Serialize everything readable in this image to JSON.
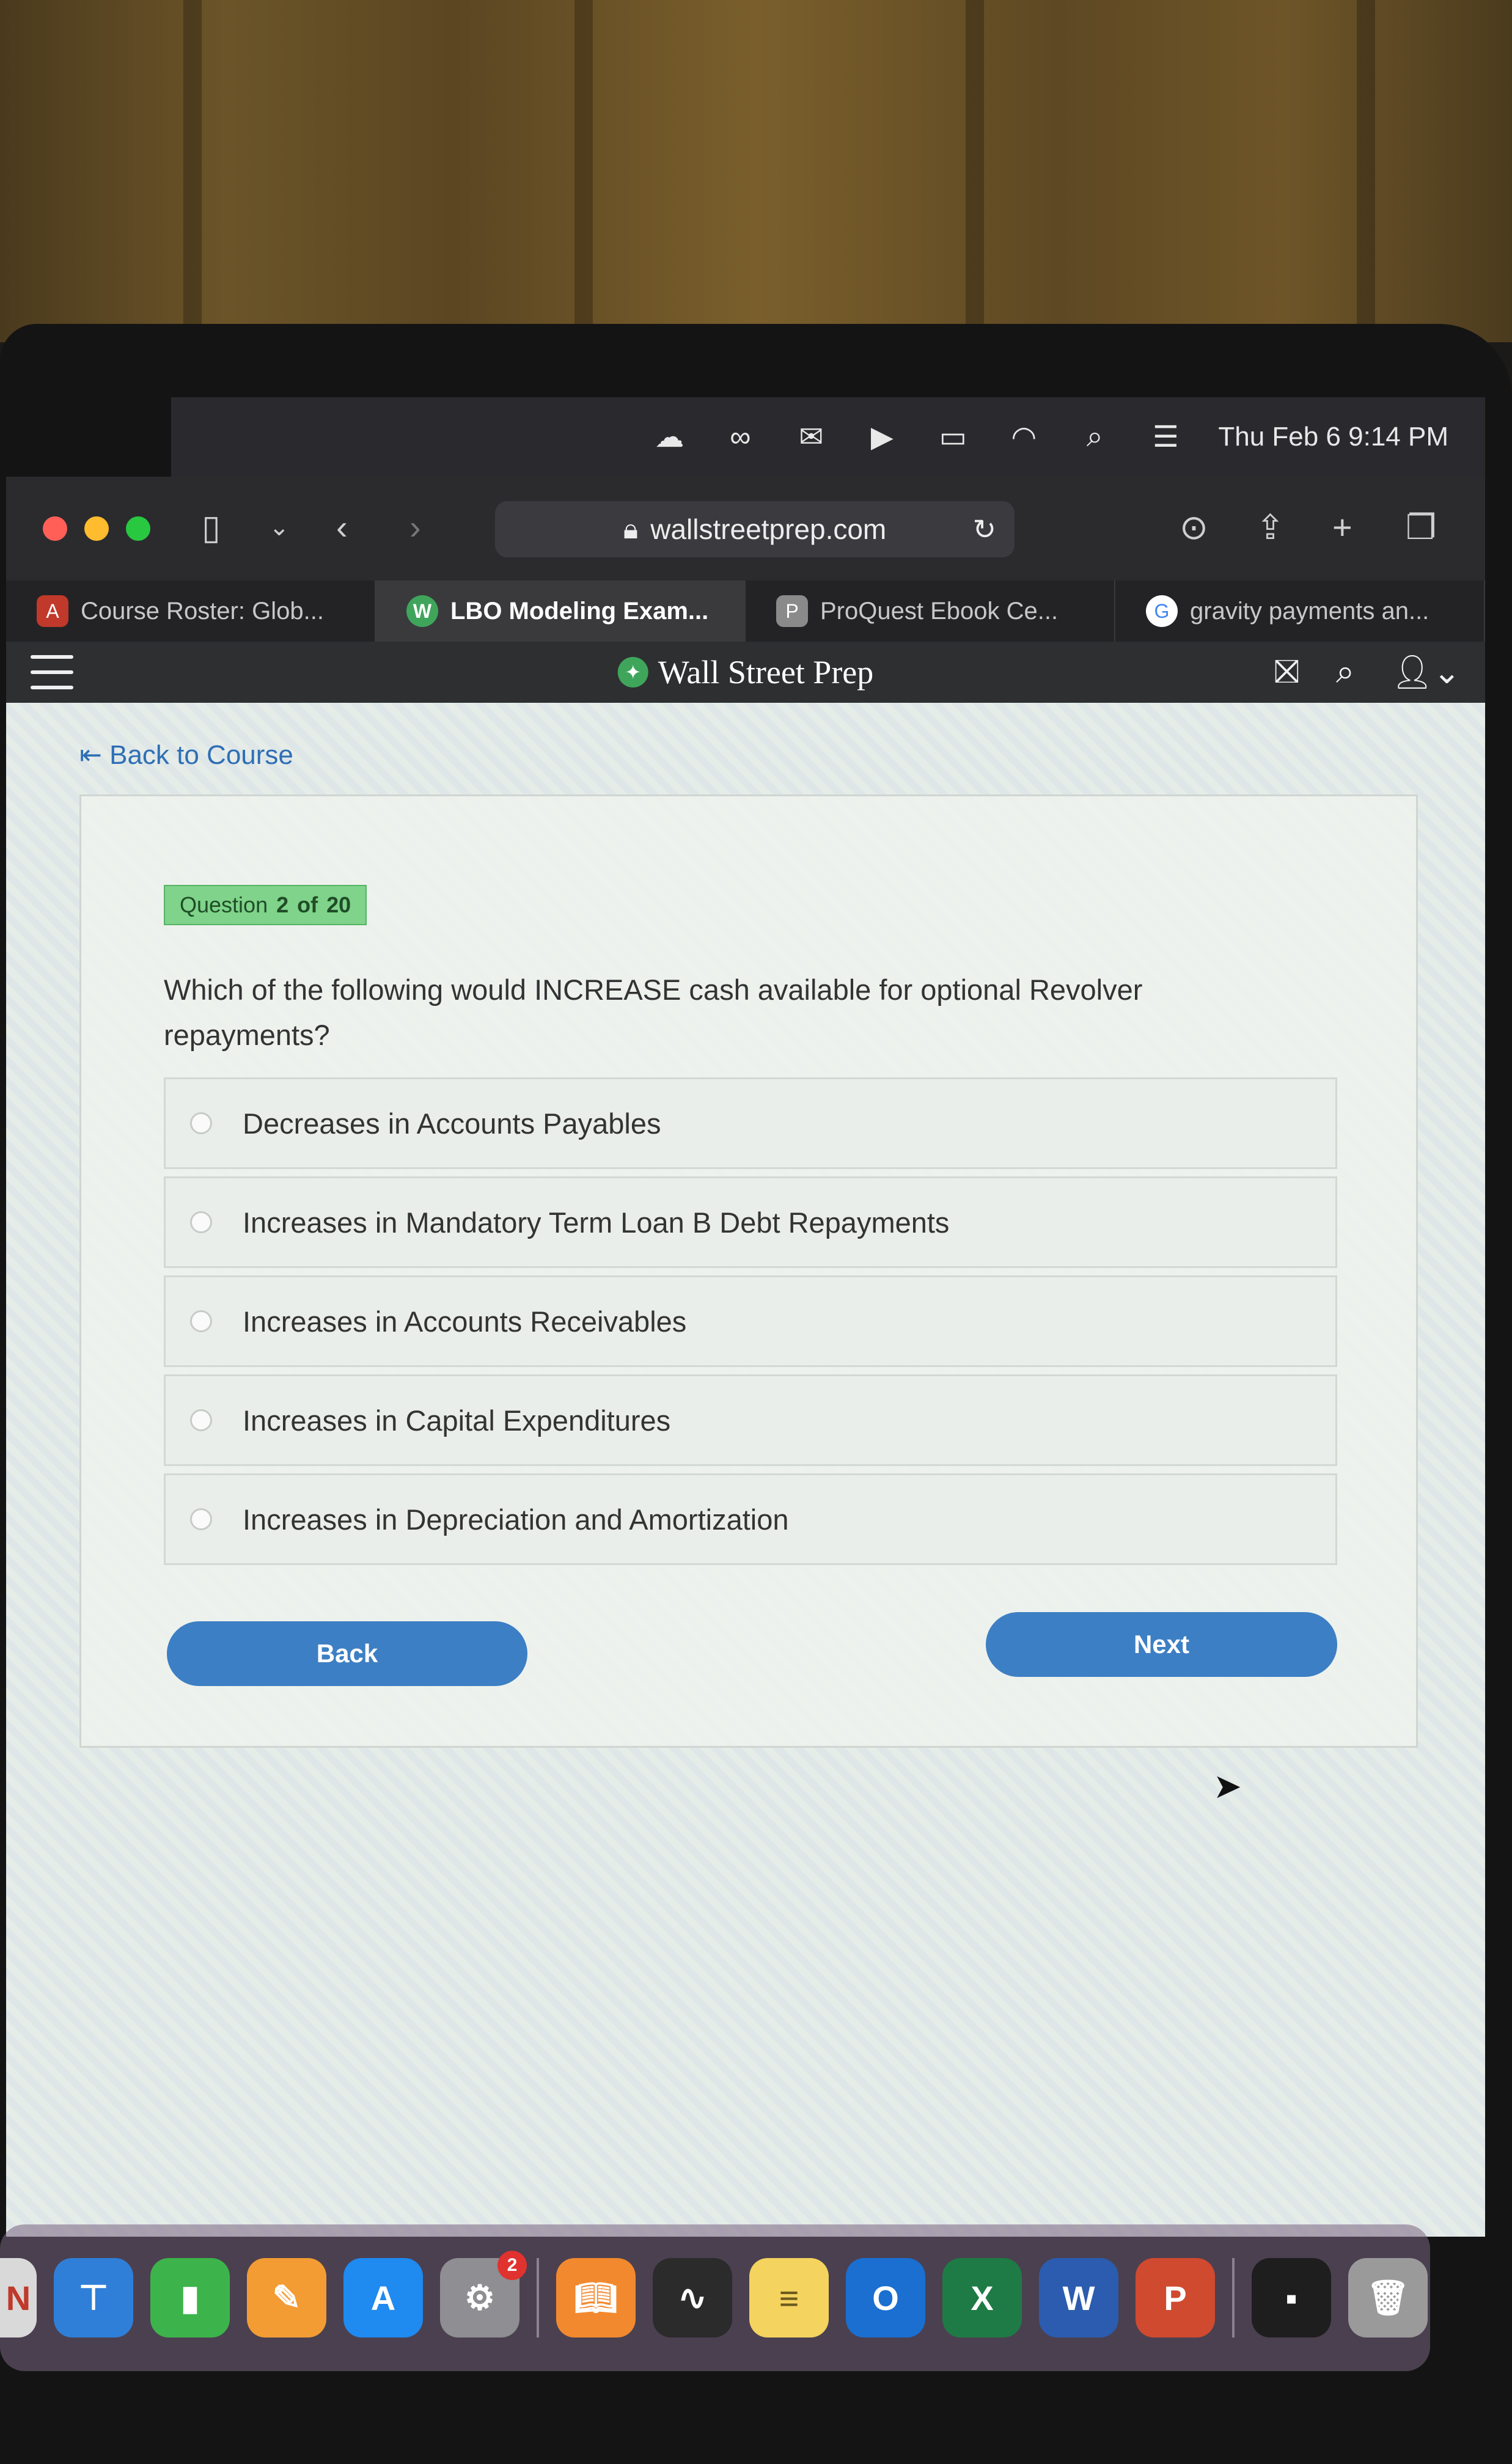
{
  "menubar": {
    "icons": [
      "cloud-icon",
      "creative-cloud-icon",
      "outlook-icon",
      "play-icon",
      "battery-icon",
      "wifi-icon",
      "search-icon",
      "control-center-icon"
    ],
    "datetime": "Thu Feb 6  9:14 PM"
  },
  "browser": {
    "url": "wallstreetprep.com",
    "tabs": [
      {
        "label": "Course Roster: Glob...",
        "favicon": "A"
      },
      {
        "label": "LBO Modeling Exam...",
        "favicon": "W"
      },
      {
        "label": "ProQuest Ebook Ce...",
        "favicon": "P"
      },
      {
        "label": "gravity payments an...",
        "favicon": "G"
      }
    ]
  },
  "site": {
    "brand": "Wall Street Prep",
    "back_link": "Back to Course"
  },
  "quiz": {
    "badge_prefix": "Question",
    "current": "2",
    "of_label": "of",
    "total": "20",
    "question": "Which of the following would INCREASE cash available for optional Revolver repayments?",
    "options": [
      "Decreases in Accounts Payables",
      "Increases in Mandatory Term Loan B Debt Repayments",
      "Increases in Accounts Receivables",
      "Increases in Capital Expenditures",
      "Increases in Depreciation and Amortization"
    ],
    "back_label": "Back",
    "next_label": "Next"
  },
  "dock": {
    "settings_badge": "2"
  },
  "colors": {
    "accent": "#3d7fc4",
    "badge_green": "#7fd38a",
    "link": "#2e6fb5"
  }
}
